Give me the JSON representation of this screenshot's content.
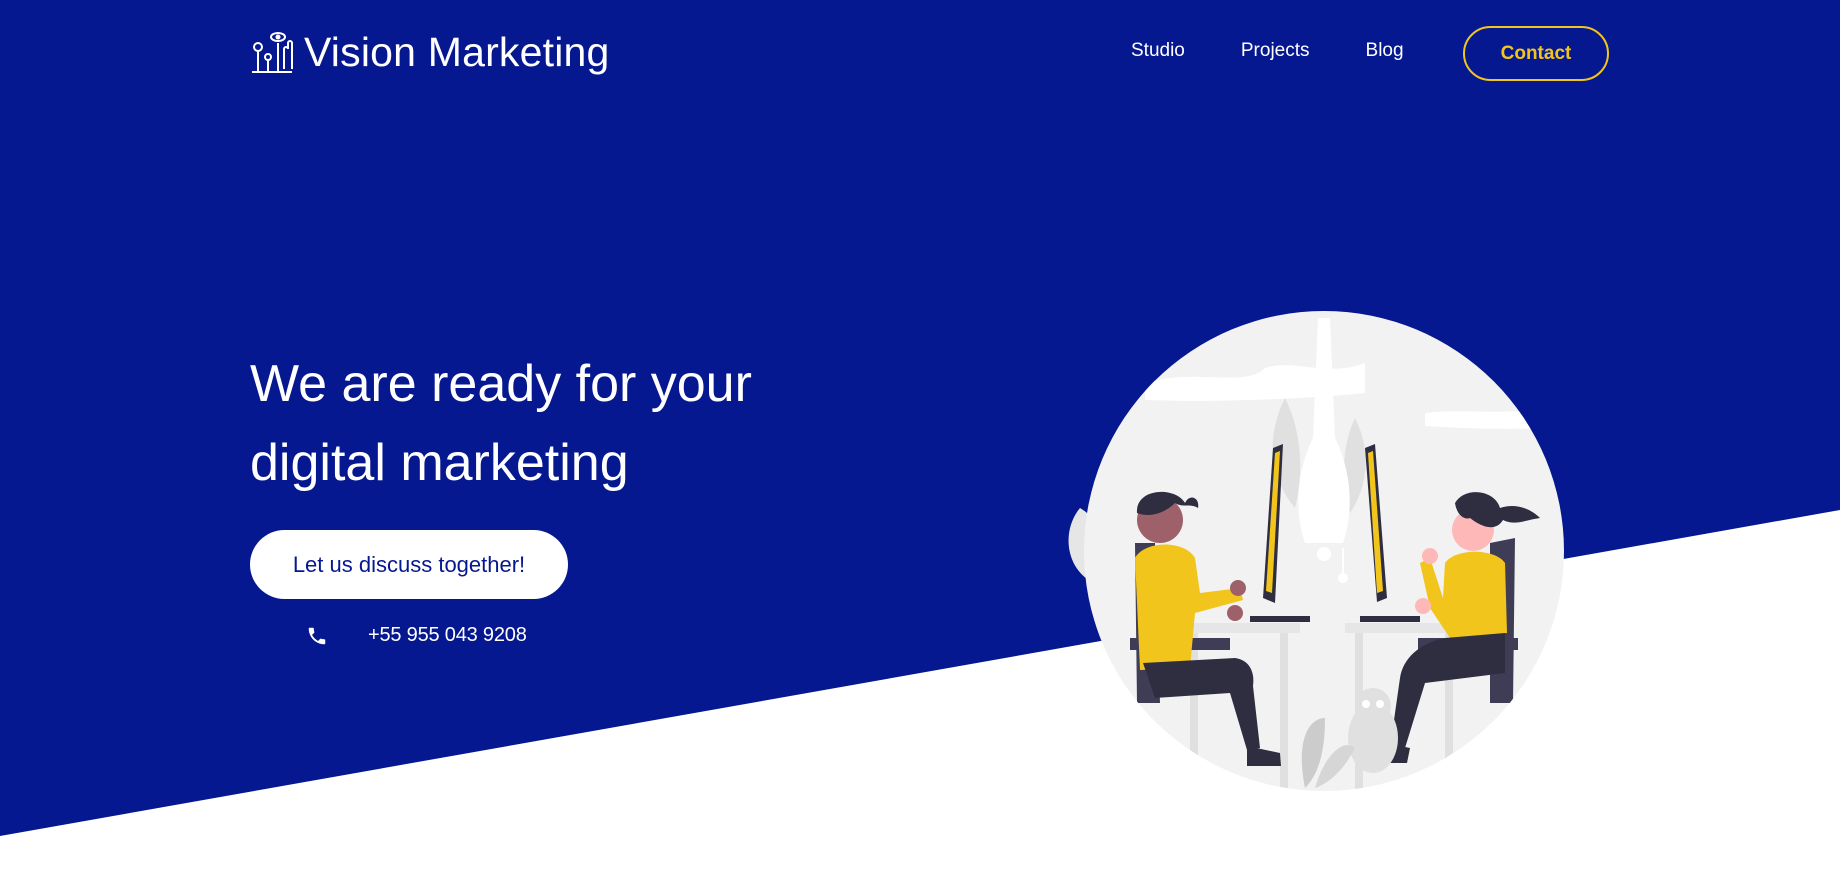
{
  "brand": {
    "name": "Vision Marketing",
    "icon": "brand-logo-icon"
  },
  "nav": {
    "items": [
      {
        "label": "Studio"
      },
      {
        "label": "Projects"
      },
      {
        "label": "Blog"
      }
    ],
    "contact_label": "Contact"
  },
  "hero": {
    "title": "We are ready for your digital marketing",
    "cta_label": "Let us discuss together!",
    "phone": "+55 955 043 9208",
    "phone_icon": "phone-icon"
  },
  "colors": {
    "primary_blue": "#06188f",
    "accent_yellow": "#f2c51c",
    "background_white": "#ffffff"
  }
}
